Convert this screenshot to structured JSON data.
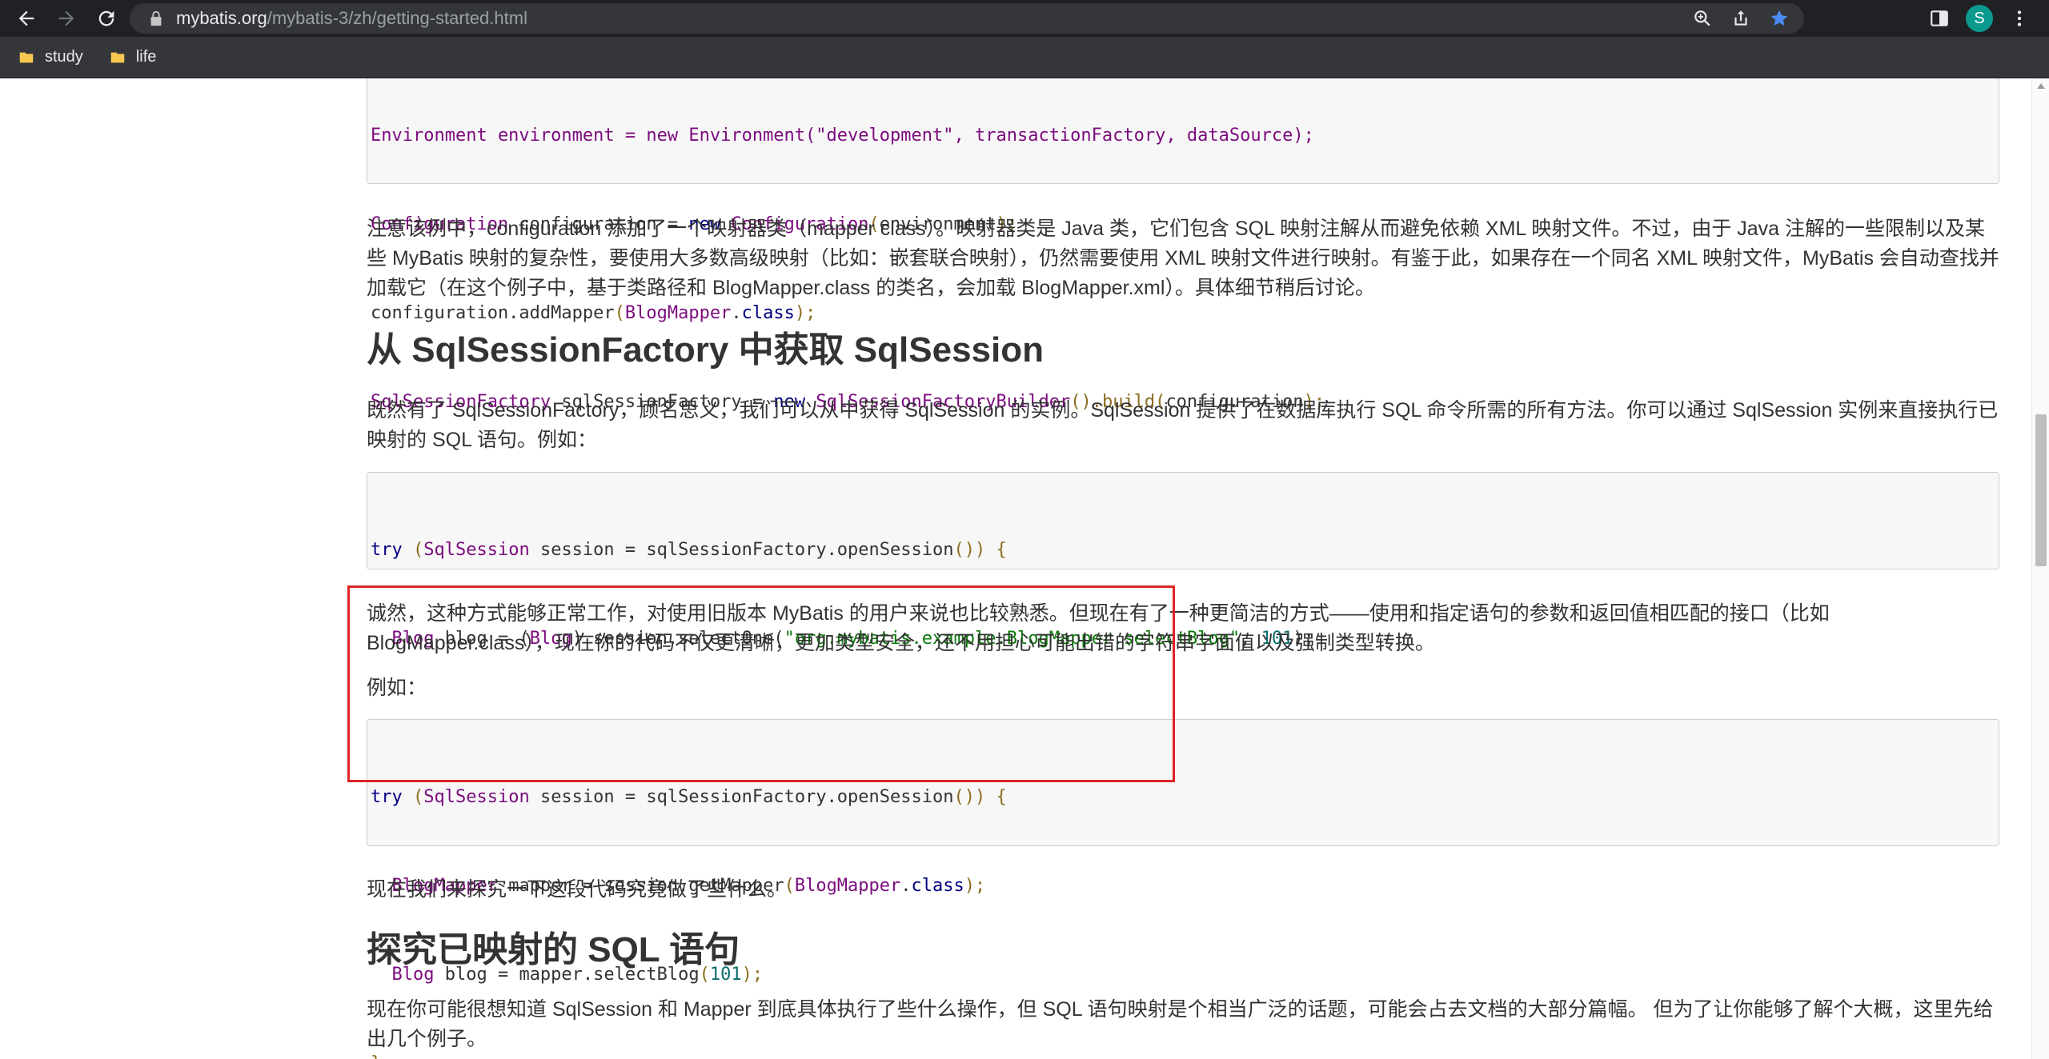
{
  "browser": {
    "url_host": "mybatis.org",
    "url_path": "/mybatis-3/zh/getting-started.html",
    "avatar_letter": "S",
    "bookmarks": [
      {
        "label": "study"
      },
      {
        "label": "life"
      }
    ],
    "accent_star": "#4c8bf5"
  },
  "page": {
    "para1": "注意该例中，configuration 添加了一个映射器类（mapper class）。映射器类是 Java 类，它们包含 SQL 映射注解从而避免依赖 XML 映射文件。不过，由于 Java 注解的一些限制以及某些 MyBatis 映射的复杂性，要使用大多数高级映射（比如：嵌套联合映射），仍然需要使用 XML 映射文件进行映射。有鉴于此，如果存在一个同名 XML 映射文件，MyBatis 会自动查找并加载它（在这个例子中，基于类路径和 BlogMapper.class 的类名，会加载 BlogMapper.xml）。具体细节稍后讨论。",
    "heading1": "从 SqlSessionFactory 中获取 SqlSession",
    "para2": "既然有了 SqlSessionFactory，顾名思义，我们可以从中获得 SqlSession 的实例。SqlSession 提供了在数据库执行 SQL 命令所需的所有方法。你可以通过 SqlSession 实例来直接执行已映射的 SQL 语句。例如：",
    "para3": "诚然，这种方式能够正常工作，对使用旧版本 MyBatis 的用户来说也比较熟悉。但现在有了一种更简洁的方式——使用和指定语句的参数和返回值相匹配的接口（比如 BlogMapper.class），现在你的代码不仅更清晰，更加类型安全，还不用担心可能出错的字符串字面值以及强制类型转换。",
    "para4": "例如：",
    "para5": "现在我们来探究一下这段代码究竟做了些什么。",
    "heading2": "探究已映射的 SQL 语句",
    "para6": "现在你可能很想知道 SqlSession 和 Mapper 到底具体执行了些什么操作，但 SQL 语句映射是个相当广泛的话题，可能会占去文档的大部分篇幅。 但为了让你能够了解个大概，这里先给出几个例子。"
  },
  "code": {
    "c1": {
      "l0": "Environment environment = new Environment(\"development\", transactionFactory, dataSource);",
      "l1a": "Configuration",
      "l1b": " configuration = ",
      "l1c": "new",
      "l1d": " ",
      "l1e": "Configuration",
      "l1f": "(",
      "l1g": "environment",
      "l1h": ");",
      "l2a": "configuration.addMapper",
      "l2b": "(",
      "l2c": "BlogMapper",
      "l2d": ".",
      "l2e": "class",
      "l2f": ");",
      "l3a": "SqlSessionFactory",
      "l3b": " sqlSessionFactory = ",
      "l3c": "new",
      "l3d": " ",
      "l3e": "SqlSessionFactoryBuilder",
      "l3f": "().build(",
      "l3g": "configuration",
      "l3h": ");"
    },
    "c2": {
      "l1a": "try",
      "l1b": " (",
      "l1c": "SqlSession",
      "l1d": " session = sqlSessionFactory.openSession",
      "l1e": "())",
      "l1f": " {",
      "l2a": "  ",
      "l2b": "Blog",
      "l2c": " blog = (",
      "l2d": "Blog",
      "l2e": ") session.selectOne(",
      "l2f": "\"org.mybatis.example.BlogMapper.selectBlog\"",
      "l2g": ", ",
      "l2h": "101",
      "l2i": ");",
      "l3": "}"
    },
    "c3": {
      "l1a": "try",
      "l1b": " (",
      "l1c": "SqlSession",
      "l1d": " session = sqlSessionFactory.openSession",
      "l1e": "())",
      "l1f": " {",
      "l2a": "  ",
      "l2b": "BlogMapper",
      "l2c": " mapper = session.getMapper",
      "l2d": "(",
      "l2e": "BlogMapper",
      "l2f": ".",
      "l2g": "class",
      "l2h": ");",
      "l3a": "  ",
      "l3b": "Blog",
      "l3c": " blog = mapper.selectBlog",
      "l3d": "(",
      "l3e": "101",
      "l3f": ");",
      "l4": "}"
    }
  }
}
